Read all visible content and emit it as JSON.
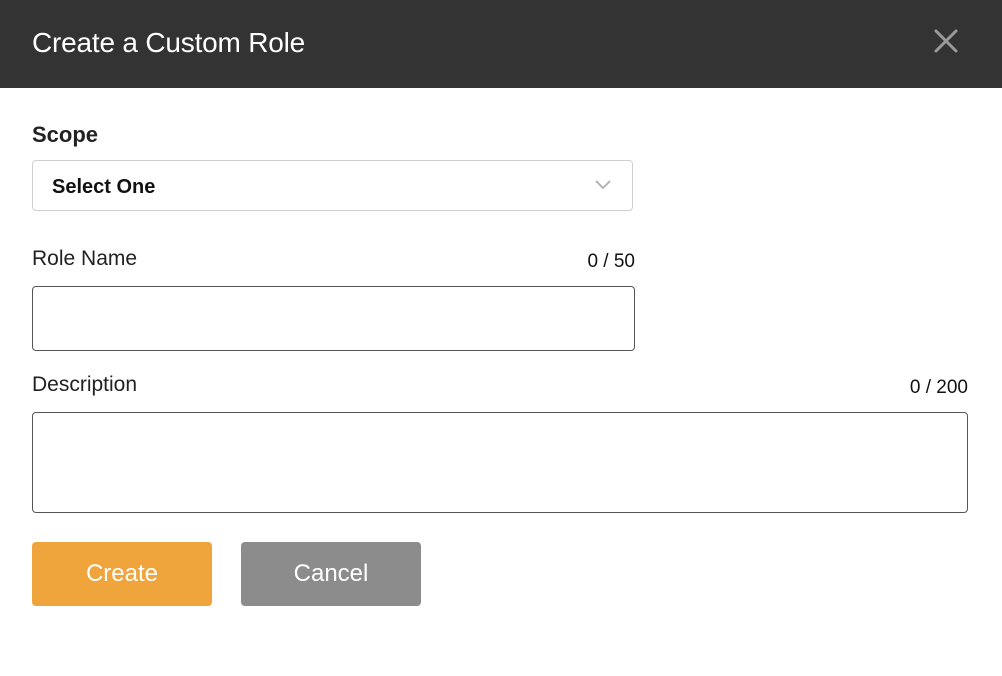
{
  "dialog": {
    "title": "Create a Custom Role",
    "close_icon": "close-icon"
  },
  "scope": {
    "label": "Scope",
    "selected": "Select One",
    "chevron_icon": "chevron-down-icon"
  },
  "role_name": {
    "label": "Role Name",
    "counter": "0 / 50",
    "value": "",
    "placeholder": ""
  },
  "description": {
    "label": "Description",
    "counter": "0 / 200",
    "value": "",
    "placeholder": ""
  },
  "actions": {
    "create_label": "Create",
    "cancel_label": "Cancel"
  },
  "colors": {
    "header_bg": "#333333",
    "create_bg": "#f0a43c",
    "cancel_bg": "#8c8c8c"
  }
}
